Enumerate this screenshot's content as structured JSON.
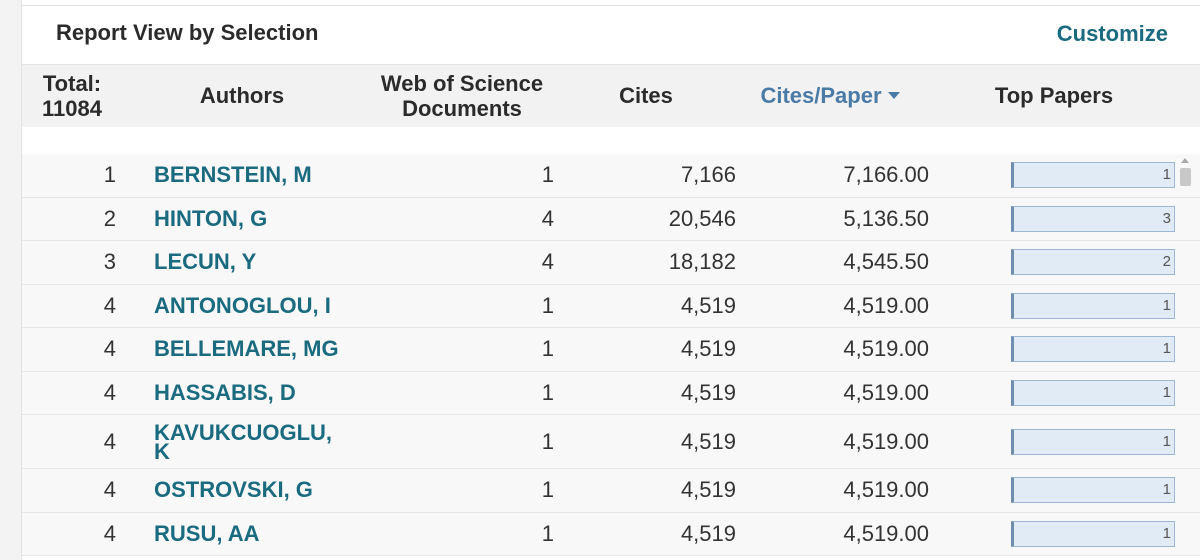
{
  "report": {
    "title": "Report View by Selection",
    "customize_label": "Customize"
  },
  "headers": {
    "total_label": "Total:",
    "total_value": "11084",
    "authors": "Authors",
    "wos_line1": "Web of Science",
    "wos_line2": "Documents",
    "cites": "Cites",
    "cites_per_paper": "Cites/Paper",
    "top_papers": "Top Papers"
  },
  "rows": [
    {
      "rank": "1",
      "author": "BERNSTEIN, M",
      "docs": "1",
      "cites": "7,166",
      "cites_per_paper": "7,166.00",
      "top_papers": "1"
    },
    {
      "rank": "2",
      "author": "HINTON, G",
      "docs": "4",
      "cites": "20,546",
      "cites_per_paper": "5,136.50",
      "top_papers": "3"
    },
    {
      "rank": "3",
      "author": "LECUN, Y",
      "docs": "4",
      "cites": "18,182",
      "cites_per_paper": "4,545.50",
      "top_papers": "2"
    },
    {
      "rank": "4",
      "author": "ANTONOGLOU, I",
      "docs": "1",
      "cites": "4,519",
      "cites_per_paper": "4,519.00",
      "top_papers": "1"
    },
    {
      "rank": "4",
      "author": "BELLEMARE, MG",
      "docs": "1",
      "cites": "4,519",
      "cites_per_paper": "4,519.00",
      "top_papers": "1"
    },
    {
      "rank": "4",
      "author": "HASSABIS, D",
      "docs": "1",
      "cites": "4,519",
      "cites_per_paper": "4,519.00",
      "top_papers": "1"
    },
    {
      "rank": "4",
      "author": "KAVUKCUOGLU, K",
      "docs": "1",
      "cites": "4,519",
      "cites_per_paper": "4,519.00",
      "top_papers": "1"
    },
    {
      "rank": "4",
      "author": "OSTROVSKI, G",
      "docs": "1",
      "cites": "4,519",
      "cites_per_paper": "4,519.00",
      "top_papers": "1"
    },
    {
      "rank": "4",
      "author": "RUSU, AA",
      "docs": "1",
      "cites": "4,519",
      "cites_per_paper": "4,519.00",
      "top_papers": "1"
    }
  ]
}
